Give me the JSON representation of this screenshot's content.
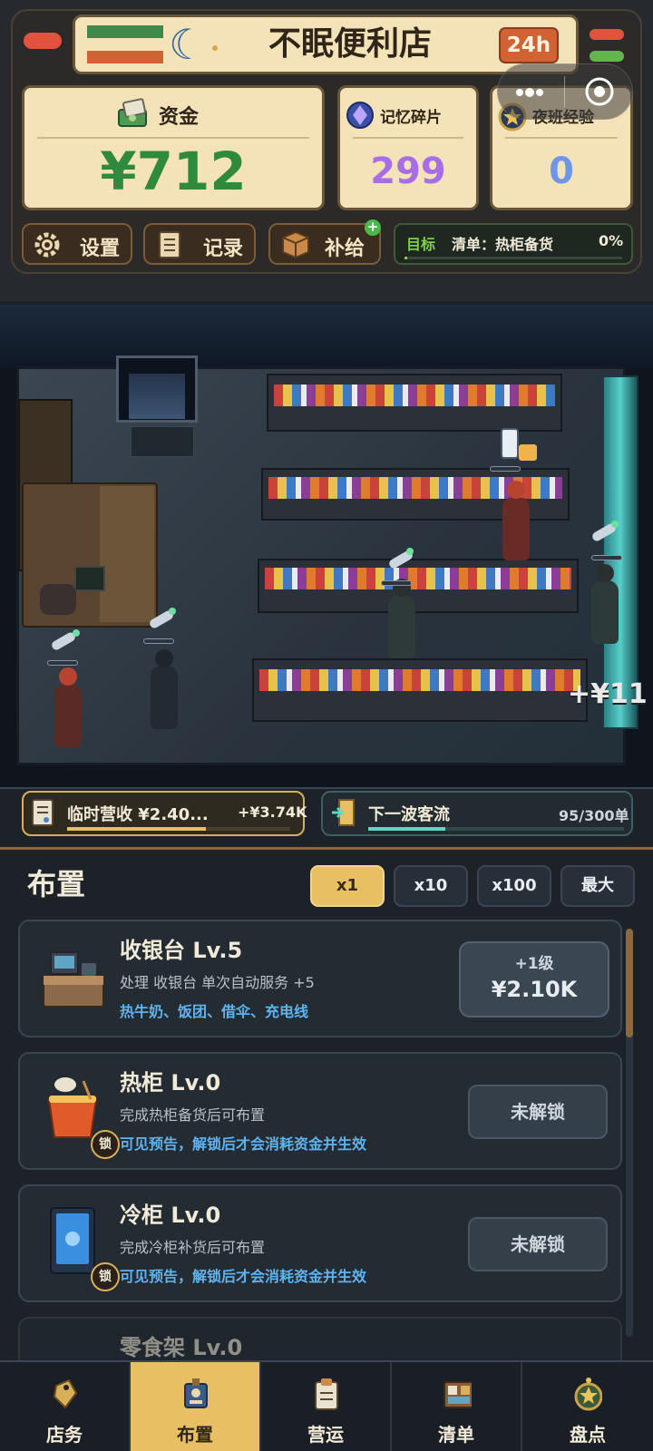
{
  "header": {
    "title": "不眠便利店",
    "hours_badge": "24h"
  },
  "stats": {
    "money": {
      "label": "资金",
      "value": "¥712"
    },
    "memory": {
      "label": "记忆碎片",
      "value": "299"
    },
    "night_exp": {
      "label": "夜班经验",
      "value": "0"
    }
  },
  "toolbar": {
    "settings": "设置",
    "records": "记录",
    "supply": "补给",
    "supply_plus": "+"
  },
  "goal": {
    "label": "目标",
    "text": "清单：热柜备货",
    "percent": "0%",
    "progress": 0
  },
  "scene": {
    "floating_income": "+¥11"
  },
  "status": {
    "revenue_text": "临时营收 ¥2.40...",
    "revenue_gain": "+¥3.74K",
    "revenue_progress": 0.62,
    "wave_text": "下一波客流",
    "wave_count": "95/300单",
    "wave_progress": 0.3
  },
  "layout_panel": {
    "title": "布置",
    "multipliers": [
      "x1",
      "x10",
      "x100",
      "最大"
    ],
    "active_multiplier": "x1",
    "lock_badge": "锁",
    "items": [
      {
        "title": "收银台  Lv.5",
        "desc": "处理 收银台  单次自动服务 +5",
        "note": "热牛奶、饭团、借伞、充电线",
        "button_top": "+1级",
        "button_price": "¥2.10K"
      },
      {
        "title": "热柜  Lv.0",
        "desc": "完成热柜备货后可布置",
        "note": "可见预告，解锁后才会消耗资金并生效",
        "button": "未解锁"
      },
      {
        "title": "冷柜  Lv.0",
        "desc": "完成冷柜补货后可布置",
        "note": "可见预告，解锁后才会消耗资金并生效",
        "button": "未解锁"
      },
      {
        "title": "零食架  Lv.0"
      }
    ]
  },
  "nav": {
    "items": [
      "店务",
      "布置",
      "营运",
      "清单",
      "盘点"
    ],
    "active": "布置"
  },
  "colors": {
    "money": "#2f8a3d",
    "memory": "#a86ee6",
    "exp": "#6d97e6",
    "accent": "#e8bf62"
  }
}
